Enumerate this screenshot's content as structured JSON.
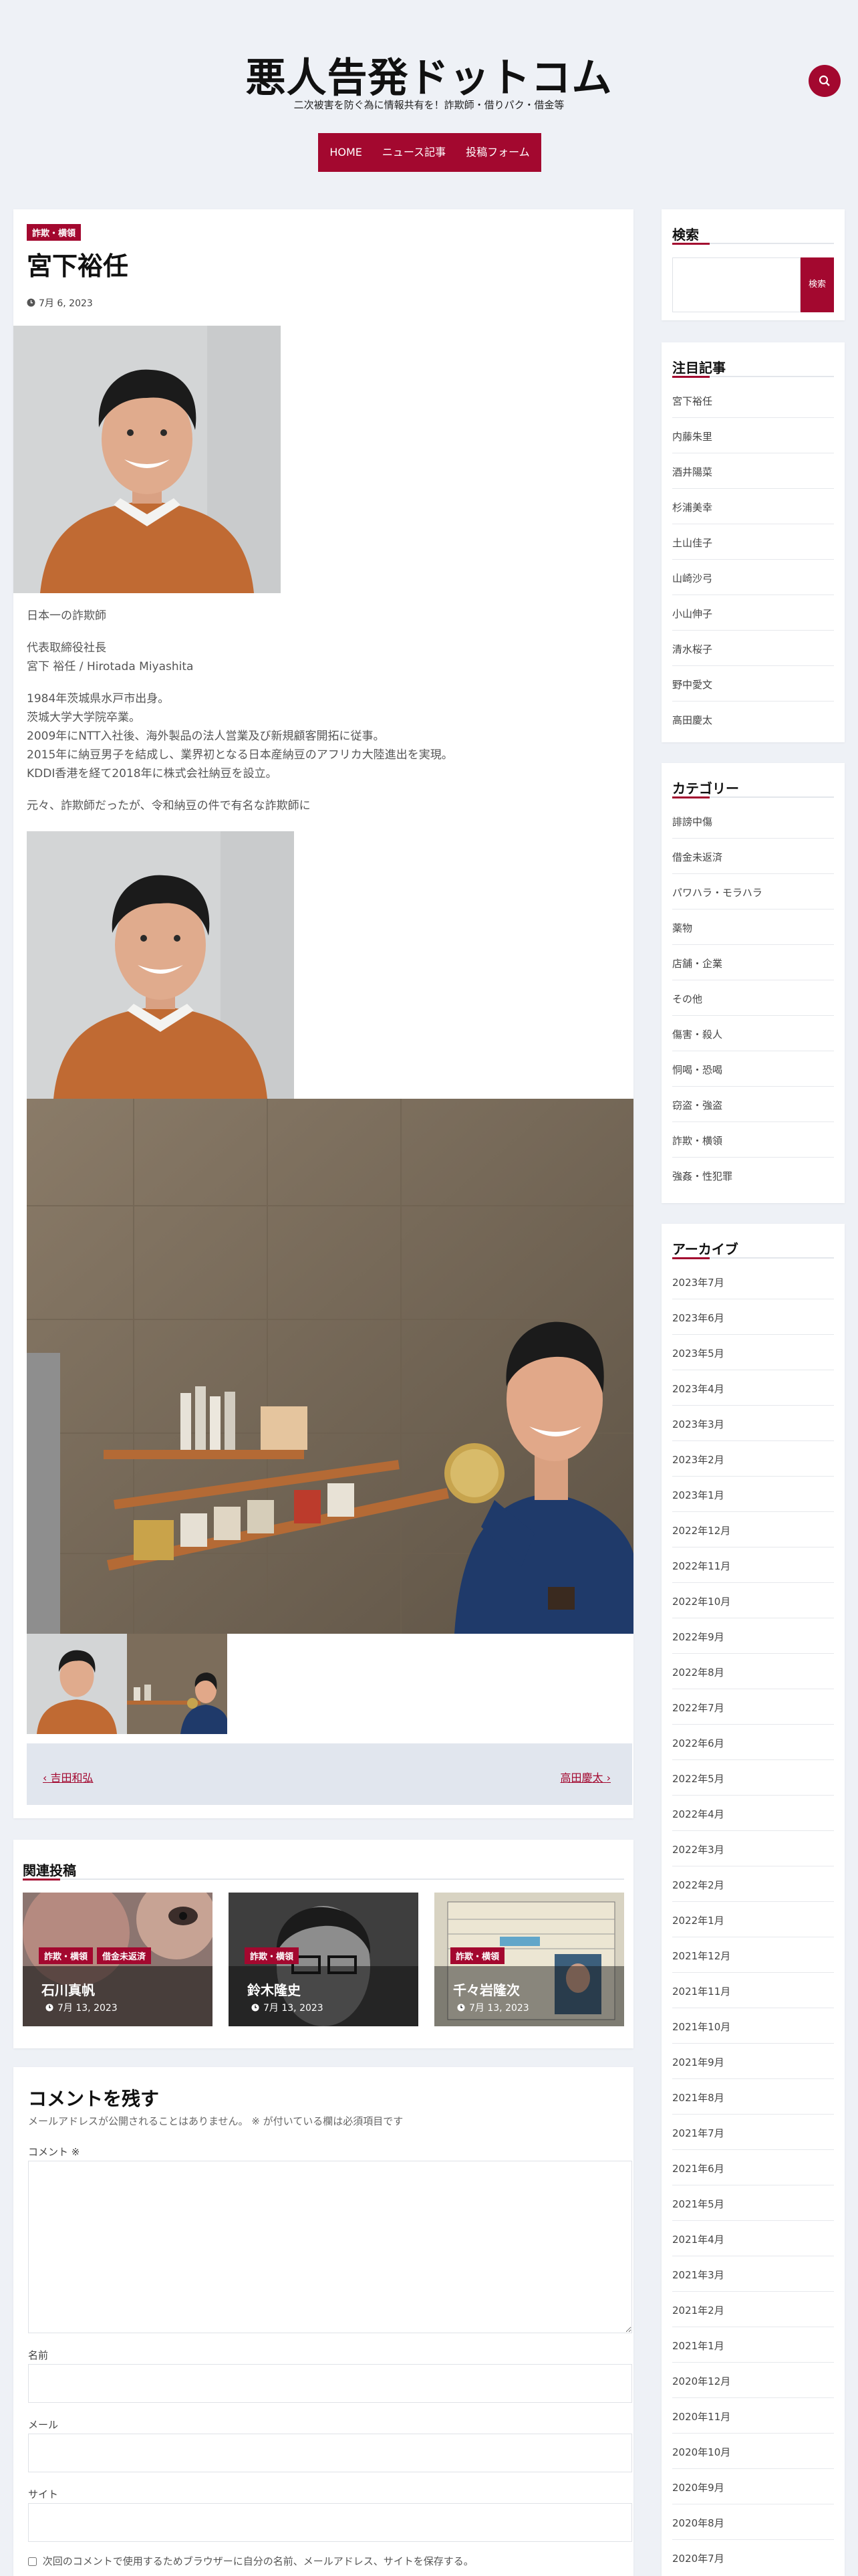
{
  "header": {
    "title": "悪人告発ドットコム",
    "tagline": "二次被害を防ぐ為に情報共有を！詐欺師・借りパク・借金等",
    "search_icon": "search-icon"
  },
  "nav": {
    "items": [
      "HOME",
      "ニュース記事",
      "投稿フォーム"
    ]
  },
  "post": {
    "category": "詐欺・横領",
    "title": "宮下裕任",
    "date": "7月 6, 2023",
    "paragraphs": [
      "日本一の詐欺師",
      "代表取締役社長",
      "宮下 裕任 / Hirotada Miyashita",
      "1984年茨城県水戸市出身。",
      "茨城大学大学院卒業。",
      "2009年にNTT入社後、海外製品の法人営業及び新規顧客開拓に従事。",
      "2015年に納豆男子を結成し、業界初となる日本産納豆のアフリカ大陸進出を実現。",
      "KDDI香港を経て2018年に株式会社納豆を設立。",
      "元々、詐欺師だったが、令和納豆の件で有名な詐欺師に"
    ],
    "prev": "吉田和弘",
    "next": "高田慶太"
  },
  "related": {
    "heading": "関連投稿",
    "items": [
      {
        "badges": [
          "詐欺・横領",
          "借金未返済"
        ],
        "title": "石川真帆",
        "date": "7月 13, 2023"
      },
      {
        "badges": [
          "詐欺・横領"
        ],
        "title": "鈴木隆史",
        "date": "7月 13, 2023"
      },
      {
        "badges": [
          "詐欺・横領"
        ],
        "title": "千々岩隆次",
        "date": "7月 13, 2023"
      }
    ]
  },
  "comment": {
    "heading": "コメントを残す",
    "note": "メールアドレスが公開されることはありません。 ※ が付いている欄は必須項目です",
    "comment_label": "コメント ※",
    "name_label": "名前",
    "email_label": "メール",
    "site_label": "サイト",
    "save_label": "次回のコメントで使用するためブラウザーに自分の名前、メールアドレス、サイトを保存する。"
  },
  "sidebar": {
    "search": {
      "heading": "検索",
      "button": "検索"
    },
    "featured": {
      "heading": "注目記事",
      "items": [
        "宮下裕任",
        "内藤朱里",
        "酒井陽菜",
        "杉浦美幸",
        "土山佳子",
        "山崎沙弓",
        "小山伸子",
        "清水桜子",
        "野中愛文",
        "高田慶太"
      ]
    },
    "categories": {
      "heading": "カテゴリー",
      "items": [
        "誹謗中傷",
        "借金未返済",
        "パワハラ・モラハラ",
        "薬物",
        "店舗・企業",
        "その他",
        "傷害・殺人",
        "恫喝・恐喝",
        "窃盗・強盗",
        "詐欺・横領",
        "強姦・性犯罪"
      ]
    },
    "archives": {
      "heading": "アーカイブ",
      "items": [
        "2023年7月",
        "2023年6月",
        "2023年5月",
        "2023年4月",
        "2023年3月",
        "2023年2月",
        "2023年1月",
        "2022年12月",
        "2022年11月",
        "2022年10月",
        "2022年9月",
        "2022年8月",
        "2022年7月",
        "2022年6月",
        "2022年5月",
        "2022年4月",
        "2022年3月",
        "2022年2月",
        "2022年1月",
        "2021年12月",
        "2021年11月",
        "2021年10月",
        "2021年9月",
        "2021年8月",
        "2021年7月",
        "2021年6月",
        "2021年5月",
        "2021年4月",
        "2021年3月",
        "2021年2月",
        "2021年1月",
        "2020年12月",
        "2020年11月",
        "2020年10月",
        "2020年9月",
        "2020年8月",
        "2020年7月"
      ]
    }
  },
  "colors": {
    "accent": "#a3082f",
    "background": "#eef1f6"
  }
}
